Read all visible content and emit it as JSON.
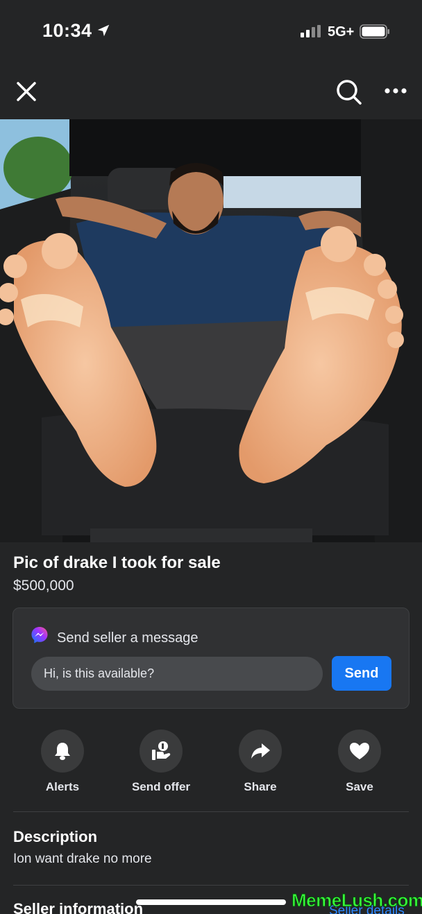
{
  "status_bar": {
    "time": "10:34",
    "network": "5G+"
  },
  "nav": {
    "close_icon": "close-icon",
    "search_icon": "search-icon",
    "more_icon": "more-icon"
  },
  "listing": {
    "title": "Pic of drake I took for sale",
    "price": "$500,000"
  },
  "message_card": {
    "heading": "Send seller a message",
    "input_value": "Hi, is this available?",
    "send_label": "Send"
  },
  "actions": [
    {
      "label": "Alerts",
      "icon": "bell-icon"
    },
    {
      "label": "Send offer",
      "icon": "offer-icon"
    },
    {
      "label": "Share",
      "icon": "share-icon"
    },
    {
      "label": "Save",
      "icon": "heart-icon"
    }
  ],
  "description": {
    "heading": "Description",
    "text": "Ion want drake no more"
  },
  "seller": {
    "heading": "Seller information",
    "link": "Seller details"
  },
  "watermark": "MemeLush.com",
  "colors": {
    "background": "#242526",
    "accent": "#1877f2",
    "link": "#2d88ff",
    "watermark": "#38ff3a"
  }
}
